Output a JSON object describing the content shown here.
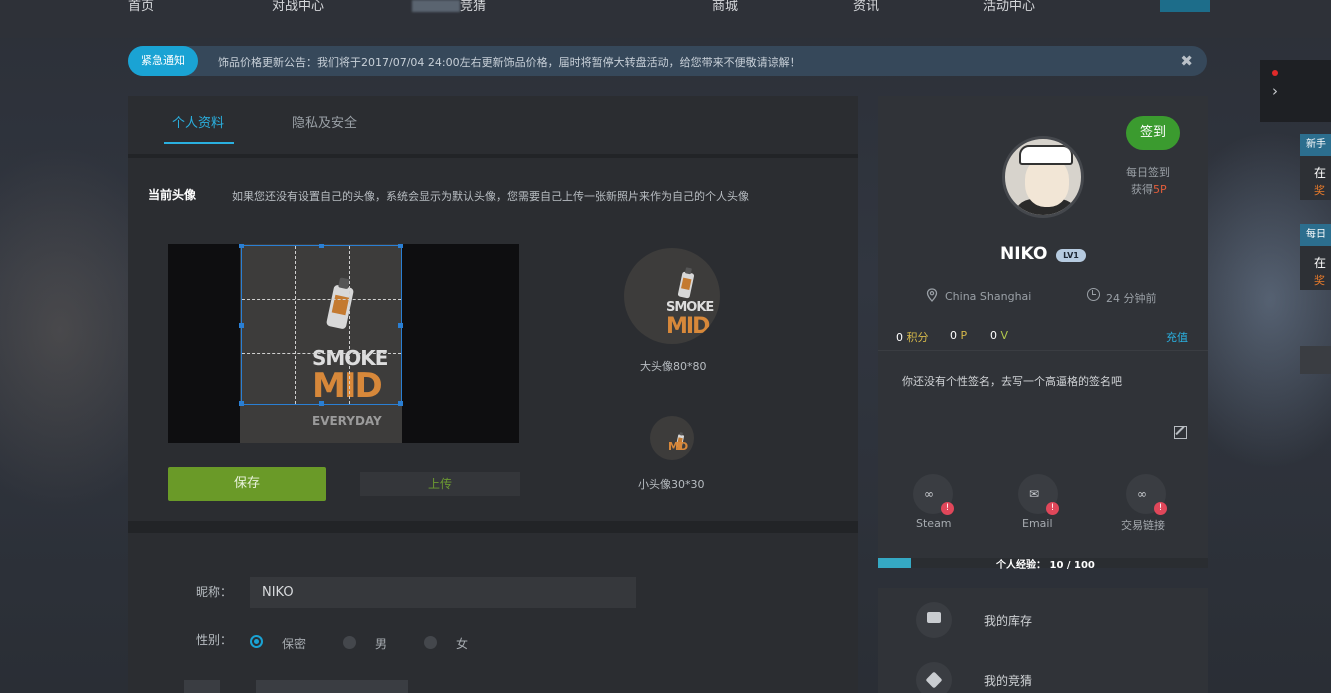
{
  "nav": {
    "items": [
      "首页",
      "对战中心",
      "竞猜",
      "商城",
      "资讯",
      "活动中心"
    ]
  },
  "notice": {
    "tag": "紧急通知",
    "text": "饰品价格更新公告：我们将于2017/07/04 24:00左右更新饰品价格，届时将暂停大转盘活动，给您带来不便敬请谅解！",
    "close": "✖"
  },
  "tabs": {
    "profile": "个人资料",
    "privacy": "隐私及安全"
  },
  "avatar_section": {
    "title": "当前头像",
    "hint": "如果您还没有设置自己的头像，系统会显示为默认头像，您需要自己上传一张新照片来作为自己的个人头像",
    "poster_line1": "SMOKE",
    "poster_line2": "MID",
    "poster_line3": "EVERYDAY",
    "large_label": "大头像80*80",
    "small_label": "小头像30*30",
    "save": "保存",
    "upload": "上传"
  },
  "form": {
    "nickname_label": "昵称：",
    "nickname_value": "NIKO",
    "gender_label": "性别：",
    "gender_options": [
      "保密",
      "男",
      "女"
    ],
    "gender_selected": "保密"
  },
  "profile": {
    "sign_button": "签到",
    "daily_sign": "每日签到",
    "earn_prefix": "获得",
    "earn_accent": "5P",
    "username": "NIKO",
    "level": "LV1",
    "location": "China Shanghai",
    "last_seen": "24 分钟前",
    "points_num": "0",
    "points_label": "积分",
    "p_num": "0",
    "p_label": "P",
    "v_num": "0",
    "v_label": "V",
    "recharge": "充值",
    "signature": "你还没有个性签名，去写一个高逼格的签名吧",
    "bindings": [
      {
        "label": "Steam",
        "badge": "!"
      },
      {
        "label": "Email",
        "badge": "!"
      },
      {
        "label": "交易链接",
        "badge": "!"
      }
    ],
    "exp_label": "个人经验： 10 / 100",
    "exp_fraction": 0.1
  },
  "menu": {
    "items": [
      "我的库存",
      "我的竞猜"
    ]
  },
  "side_tips": [
    {
      "head": "新手",
      "line1": "在",
      "line2": "奖"
    },
    {
      "head": "每日",
      "line1": "在",
      "line2": "奖"
    }
  ],
  "colors": {
    "accent_blue": "#1aa3d4",
    "save_green": "#6a9a28",
    "sign_green": "#3b9b2f",
    "badge_red": "#e0475a",
    "sp_orange": "#e35d3a"
  }
}
